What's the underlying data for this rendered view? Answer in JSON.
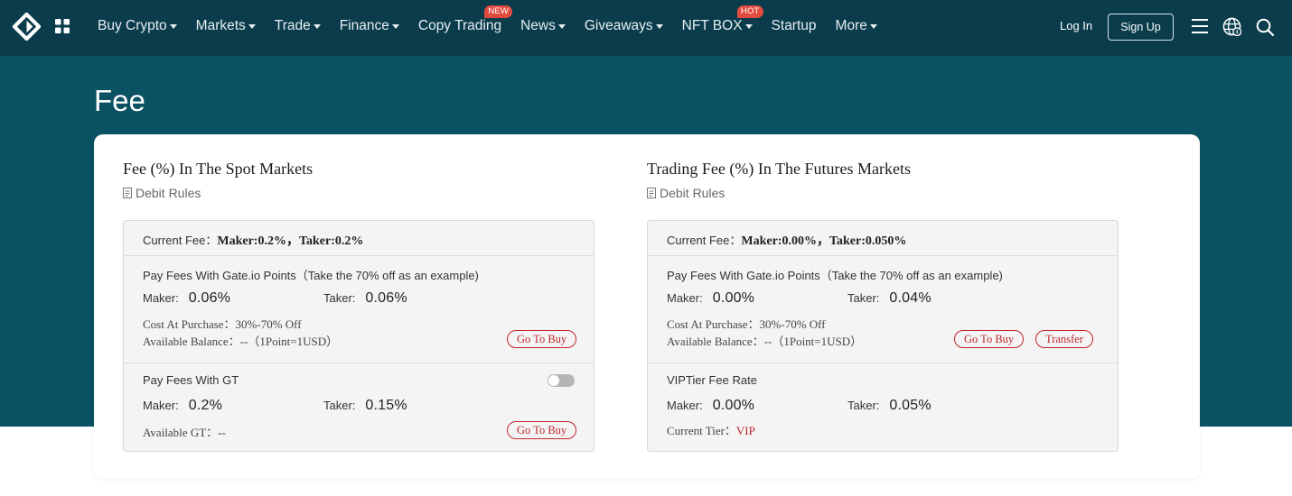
{
  "nav": {
    "items": [
      {
        "label": "Buy Crypto",
        "caret": true,
        "badge": ""
      },
      {
        "label": "Markets",
        "caret": true,
        "badge": ""
      },
      {
        "label": "Trade",
        "caret": true,
        "badge": ""
      },
      {
        "label": "Finance",
        "caret": true,
        "badge": ""
      },
      {
        "label": "Copy Trading",
        "caret": false,
        "badge": "NEW"
      },
      {
        "label": "News",
        "caret": true,
        "badge": ""
      },
      {
        "label": "Giveaways",
        "caret": true,
        "badge": ""
      },
      {
        "label": "NFT BOX",
        "caret": true,
        "badge": "HOT"
      },
      {
        "label": "Startup",
        "caret": false,
        "badge": ""
      },
      {
        "label": "More",
        "caret": true,
        "badge": ""
      }
    ],
    "login_label": "Log In",
    "signup_label": "Sign Up"
  },
  "page": {
    "title": "Fee"
  },
  "spot": {
    "title": "Fee (%) In The Spot Markets",
    "debit_rules": "Debit Rules",
    "current_label": "Current Fee：",
    "current_value": "Maker:0.2%，Taker:0.2%",
    "points": {
      "heading": "Pay Fees With Gate.io Points（Take the 70% off as an example)",
      "maker_label": "Maker:",
      "maker_value": "0.06%",
      "taker_label": "Taker:",
      "taker_value": "0.06%",
      "cost_line": "Cost At Purchase：30%-70% Off",
      "balance_line": "Available Balance：--（1Point=1USD）",
      "buy_label": "Go To Buy"
    },
    "gt": {
      "heading": "Pay Fees With GT",
      "maker_label": "Maker:",
      "maker_value": "0.2%",
      "taker_label": "Taker:",
      "taker_value": "0.15%",
      "available_line": "Available GT：--",
      "buy_label": "Go To Buy",
      "toggle_on": false
    }
  },
  "futures": {
    "title": "Trading Fee (%) In The Futures Markets",
    "debit_rules": "Debit Rules",
    "current_label": "Current Fee：",
    "current_value": "Maker:0.00%，Taker:0.050%",
    "points": {
      "heading": "Pay Fees With Gate.io Points（Take the 70% off as an example)",
      "maker_label": "Maker:",
      "maker_value": "0.00%",
      "taker_label": "Taker:",
      "taker_value": "0.04%",
      "cost_line": "Cost At Purchase：30%-70% Off",
      "balance_line": "Available Balance：--（1Point=1USD）",
      "buy_label": "Go To Buy",
      "transfer_label": "Transfer"
    },
    "vip": {
      "heading": "VIPTier Fee Rate",
      "maker_label": "Maker:",
      "maker_value": "0.00%",
      "taker_label": "Taker:",
      "taker_value": "0.05%",
      "tier_label": "Current Tier：",
      "tier_value": "VIP"
    }
  },
  "colors": {
    "nav_bg": "#0b3c4c",
    "hero_bg": "#0a5163",
    "accent_red": "#c0262d",
    "badge_red": "#e14b3f"
  }
}
